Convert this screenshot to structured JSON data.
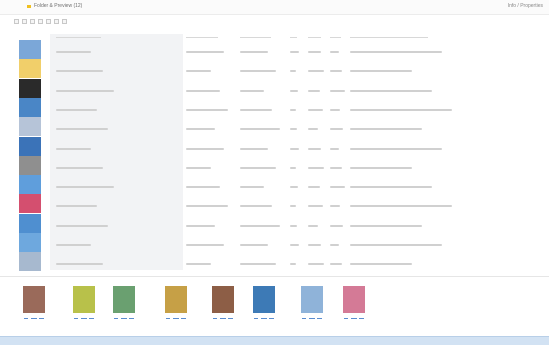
{
  "window": {
    "title": "Folder & Preview (12)",
    "right_label": "Info / Properties"
  },
  "toolbar": {
    "buttons": [
      "tool-1",
      "tool-2",
      "tool-3",
      "tool-4",
      "tool-5",
      "tool-6",
      "tool-7"
    ]
  },
  "thumbnails": [
    {
      "icon": "document-icon"
    },
    {
      "icon": "folder-icon"
    },
    {
      "icon": "video-icon"
    },
    {
      "icon": "photo-icon"
    },
    {
      "icon": "form-icon"
    },
    {
      "icon": "document-icon"
    },
    {
      "icon": "image-icon"
    },
    {
      "icon": "chart-icon"
    },
    {
      "icon": "document-icon"
    },
    {
      "icon": "document-icon"
    },
    {
      "icon": "chart-icon"
    },
    {
      "icon": "image-icon"
    }
  ],
  "colors": {
    "selection": "#f2f3f5",
    "accent": "#5a8ccf",
    "status_bar": "#d2e2f3"
  },
  "strip": [
    {
      "icon": "person-photo-icon"
    },
    {
      "icon": "person-photo-icon"
    },
    {
      "icon": "landscape-photo-icon"
    },
    {
      "icon": "person-photo-icon"
    },
    {
      "icon": "person-photo-icon"
    },
    {
      "icon": "photo-icon"
    },
    {
      "icon": "chart-icon"
    },
    {
      "icon": "document-icon"
    }
  ]
}
